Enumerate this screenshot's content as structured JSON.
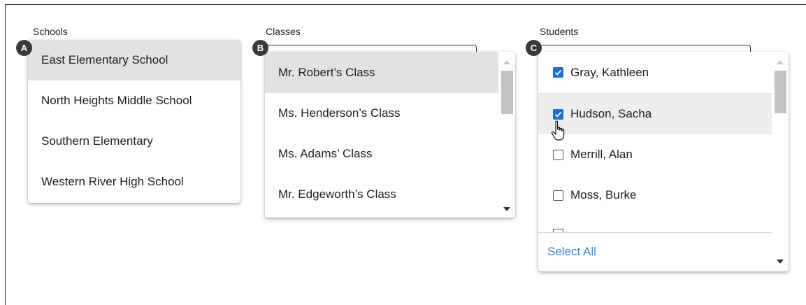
{
  "schools": {
    "label": "Schools",
    "badge": "A",
    "options": [
      "East Elementary School",
      "North Heights Middle School",
      "Southern Elementary",
      "Western River High School"
    ]
  },
  "classes": {
    "label": "Classes",
    "badge": "B",
    "options": [
      "Mr. Robert’s Class",
      "Ms. Henderson’s Class",
      "Ms. Adams’ Class",
      "Mr. Edgeworth’s Class"
    ]
  },
  "students": {
    "label": "Students",
    "badge": "C",
    "options": [
      {
        "name": "Gray, Kathleen",
        "checked": true
      },
      {
        "name": "Hudson, Sacha",
        "checked": true
      },
      {
        "name": "Merrill, Alan",
        "checked": false
      },
      {
        "name": "Moss, Burke",
        "checked": false
      }
    ],
    "select_all": "Select All"
  },
  "colors": {
    "accent": "#1e6fd0",
    "link": "#3a86d4",
    "selected_row": "#e2e2e2"
  }
}
